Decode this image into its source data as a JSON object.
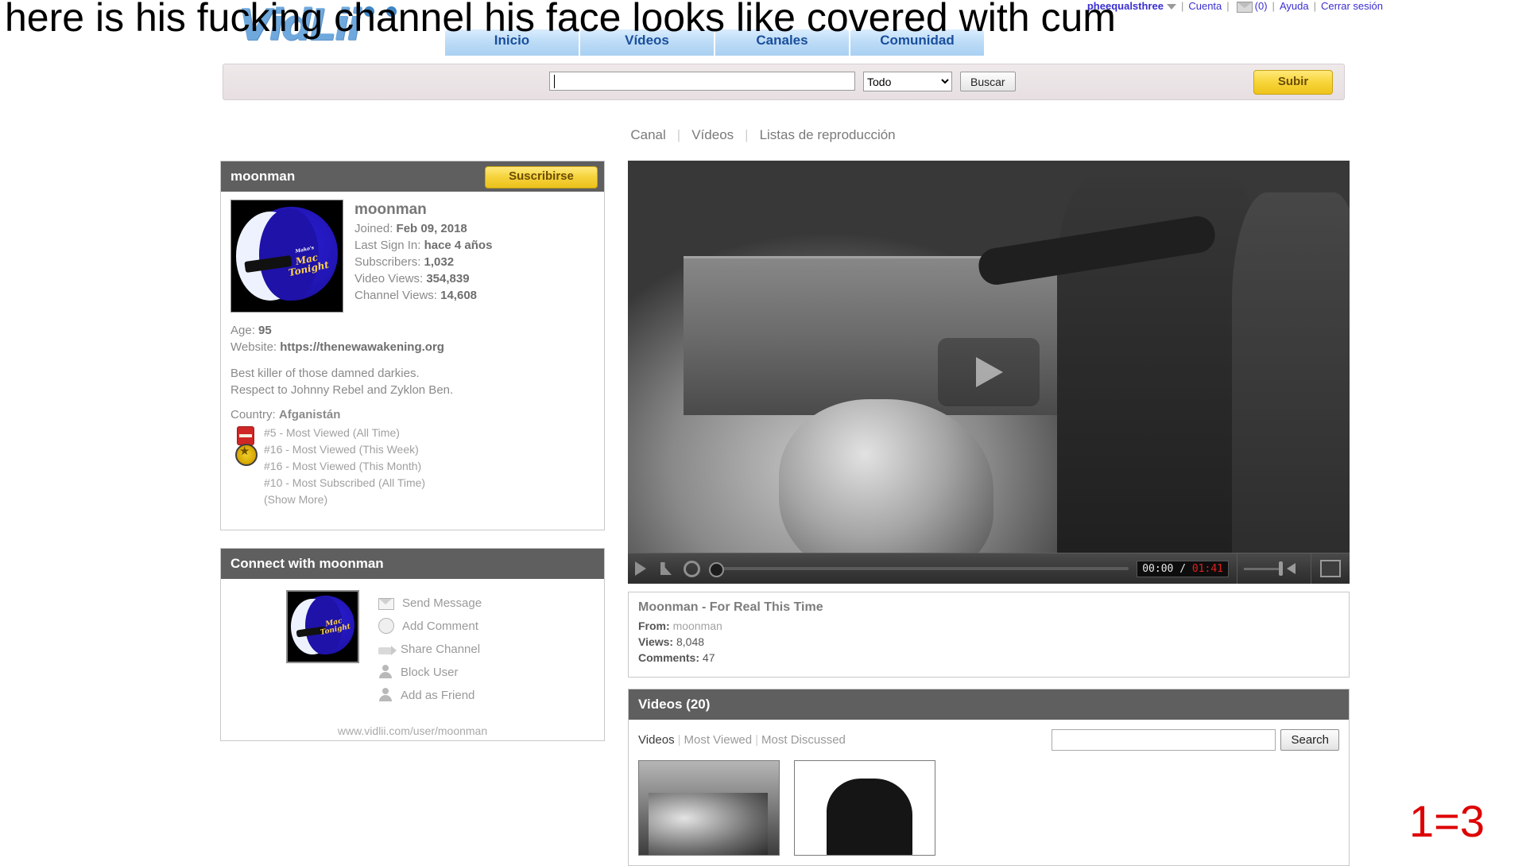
{
  "overlay": {
    "top_text": "here is his fucking channel his face looks like covered with cum",
    "corner_text": "1=3",
    "corner_color": "#dd0000"
  },
  "header": {
    "logo_text": "VidLii",
    "account_bar": {
      "username": "pheequalsthree",
      "caret": "chevron-down-icon",
      "account_link": "Cuenta",
      "inbox_icon": "envelope-icon",
      "inbox_count": "(0)",
      "help_link": "Ayuda",
      "logout_link": "Cerrar sesión",
      "separator": "|"
    },
    "nav_tabs": [
      {
        "label": "Inicio"
      },
      {
        "label": "Vídeos"
      },
      {
        "label": "Canales"
      },
      {
        "label": "Comunidad"
      }
    ],
    "search": {
      "value": "",
      "placeholder": "",
      "scope_selected": "Todo",
      "scope_options": [
        "Todo"
      ],
      "button_label": "Buscar",
      "upload_label": "Subir"
    }
  },
  "channel_tabs": [
    {
      "label": "Canal"
    },
    {
      "label": "Vídeos"
    },
    {
      "label": "Listas de reproducción"
    }
  ],
  "channel": {
    "panel_title": "moonman",
    "subscribe_label": "Suscribirse",
    "avatar_icon": "moonman-avatar",
    "display_name": "moonman",
    "stats": [
      {
        "label": "Joined:",
        "value": "Feb 09, 2018"
      },
      {
        "label": "Last Sign In:",
        "value": "hace 4 años"
      },
      {
        "label": "Subscribers:",
        "value": "1,032"
      },
      {
        "label": "Video Views:",
        "value": "354,839"
      },
      {
        "label": "Channel Views:",
        "value": "14,608"
      }
    ],
    "age_label": "Age:",
    "age_value": "95",
    "website_label": "Website:",
    "website_value": "https://thenewawakening.org",
    "description_line1": "Best killer of those damned darkies.",
    "description_line2": "Respect to Johnny Rebel and Zyklon Ben.",
    "country_label": "Country:",
    "country_value": "Afganistán",
    "ranks": [
      "#5 - Most Viewed (All Time)",
      "#16 - Most Viewed (This Week)",
      "#16 - Most Viewed (This Month)",
      "#10 - Most Subscribed (All Time)",
      "(Show More)"
    ]
  },
  "connect": {
    "title": "Connect with moonman",
    "avatar_icon": "moonman-avatar",
    "links": [
      {
        "label": "Send Message",
        "icon": "mail-icon"
      },
      {
        "label": "Add Comment",
        "icon": "comment-icon"
      },
      {
        "label": "Share Channel",
        "icon": "share-icon"
      },
      {
        "label": "Block User",
        "icon": "user-block-icon"
      },
      {
        "label": "Add as Friend",
        "icon": "user-add-icon"
      }
    ],
    "url": "www.vidlii.com/user/moonman"
  },
  "player": {
    "play_overlay_icon": "play-icon",
    "buttons": {
      "play": "play-icon",
      "stop": "stop-icon",
      "settings": "gear-icon",
      "volume": "speaker-icon",
      "fullscreen": "fullscreen-icon"
    },
    "current_time": "00:00",
    "time_separator": "/",
    "total_time": "01:41"
  },
  "video_info": {
    "title": "Moonman - For Real This Time",
    "from_label": "From:",
    "from_value": "moonman",
    "views_label": "Views:",
    "views_value": "8,048",
    "comments_label": "Comments:",
    "comments_value": "47"
  },
  "videos_section": {
    "title": "Videos (20)",
    "filters": [
      {
        "label": "Videos",
        "active": true
      },
      {
        "label": "Most Viewed",
        "active": false
      },
      {
        "label": "Most Discussed",
        "active": false
      }
    ],
    "separator": "|",
    "search_value": "",
    "search_placeholder": "",
    "search_button": "Search",
    "thumbnails": [
      {
        "name": "video-thumbnail-1"
      },
      {
        "name": "video-thumbnail-2"
      }
    ]
  }
}
